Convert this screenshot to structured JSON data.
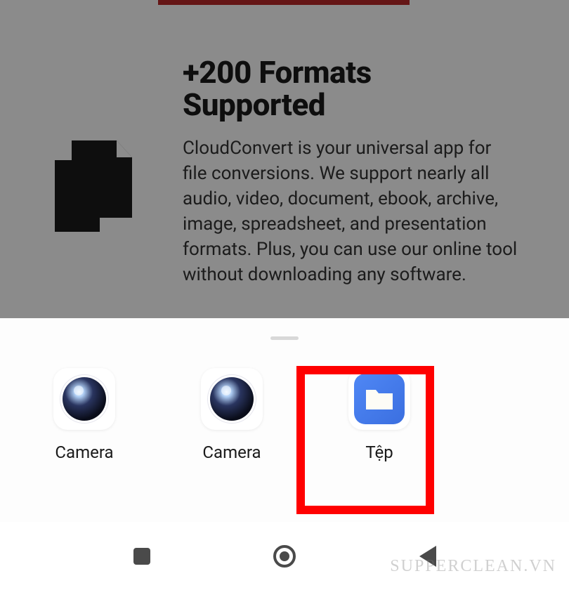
{
  "content": {
    "heading": "+200 Formats Supported",
    "body": "CloudConvert is your universal app for file conversions. We support nearly all audio, video, document, ebook, archive, image, spreadsheet, and presentation formats. Plus, you can use our online tool without downloading any software."
  },
  "sheet": {
    "apps": [
      {
        "label": "Camera",
        "icon": "camera-icon"
      },
      {
        "label": "Camera",
        "icon": "camera-icon"
      },
      {
        "label": "Tệp",
        "icon": "files-icon"
      }
    ]
  },
  "highlightIndex": 2,
  "watermark": "SUPPERCLEAN.VN"
}
